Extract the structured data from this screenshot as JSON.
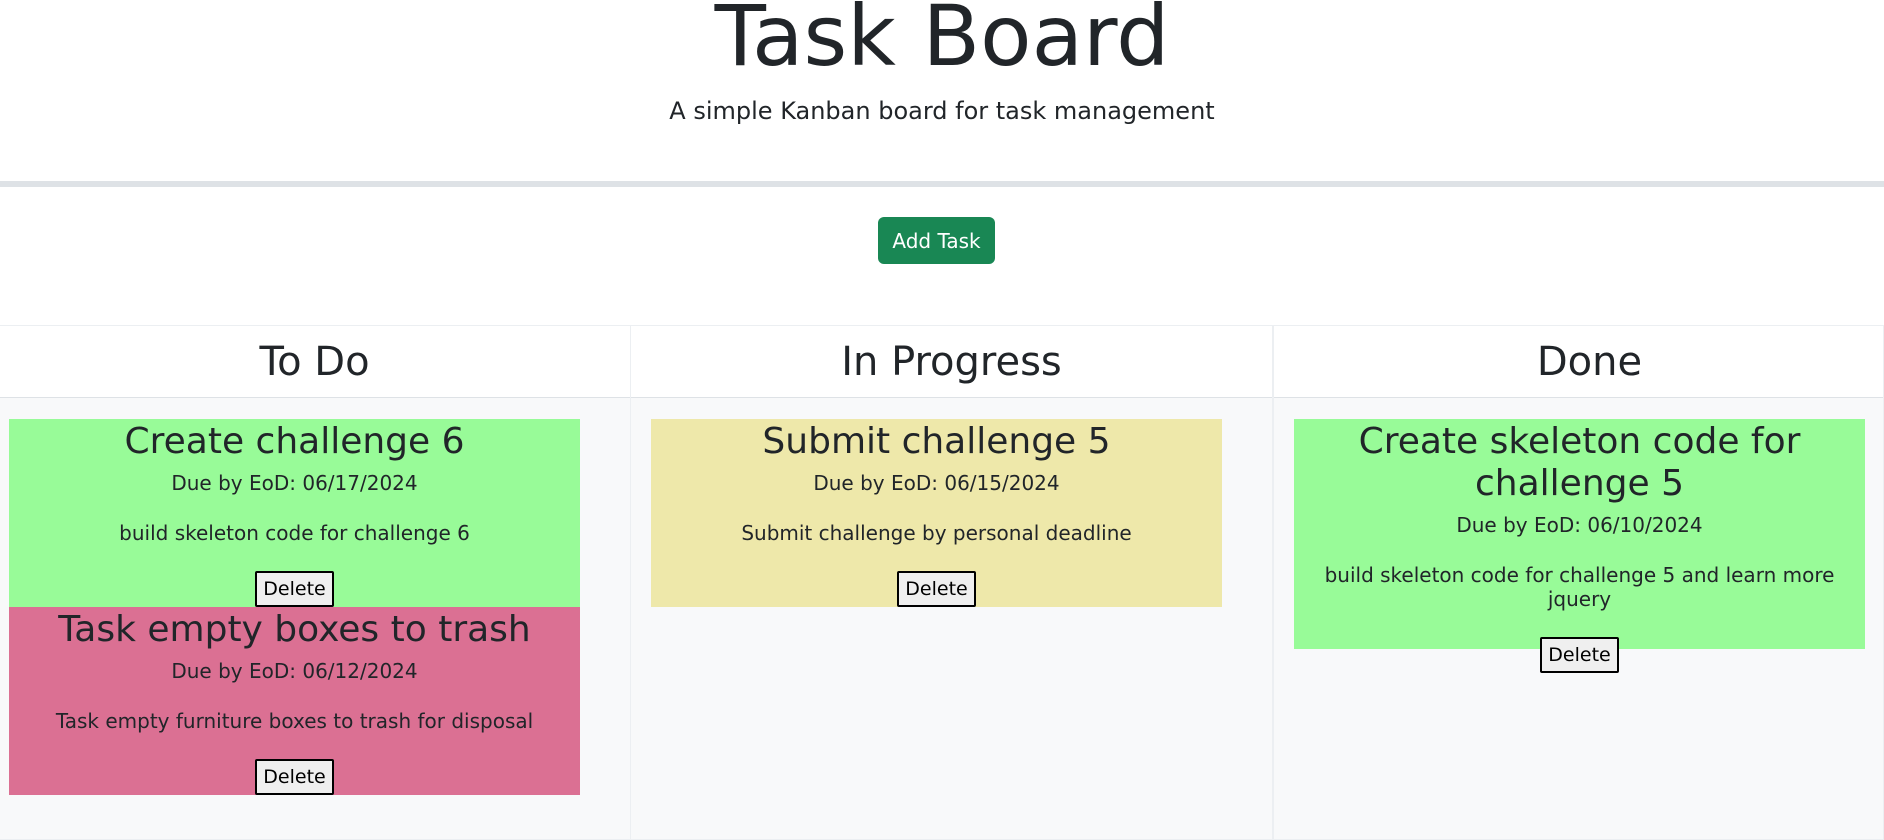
{
  "header": {
    "title": "Task Board",
    "subtitle": "A simple Kanban board for task management"
  },
  "actions": {
    "add_task_label": "Add Task"
  },
  "lanes": [
    {
      "title": "To Do",
      "cards": [
        {
          "title": "Create challenge 6",
          "due": "Due by EoD: 06/17/2024",
          "description": "build skeleton code for challenge 6",
          "delete_label": "Delete",
          "color": "#98fb98"
        },
        {
          "title": "Task empty boxes to trash",
          "due": "Due by EoD: 06/12/2024",
          "description": "Task empty furniture boxes to trash for disposal",
          "delete_label": "Delete",
          "color": "#db7093"
        }
      ]
    },
    {
      "title": "In Progress",
      "cards": [
        {
          "title": "Submit challenge 5",
          "due": "Due by EoD: 06/15/2024",
          "description": "Submit challenge by personal deadline",
          "delete_label": "Delete",
          "color": "#eee8aa"
        }
      ]
    },
    {
      "title": "Done",
      "cards": [
        {
          "title": "Create skeleton code for challenge 5",
          "due": "Due by EoD: 06/10/2024",
          "description": "build skeleton code for challenge 5 and learn more jquery",
          "delete_label": "Delete",
          "color": "#98fb98"
        }
      ]
    }
  ]
}
